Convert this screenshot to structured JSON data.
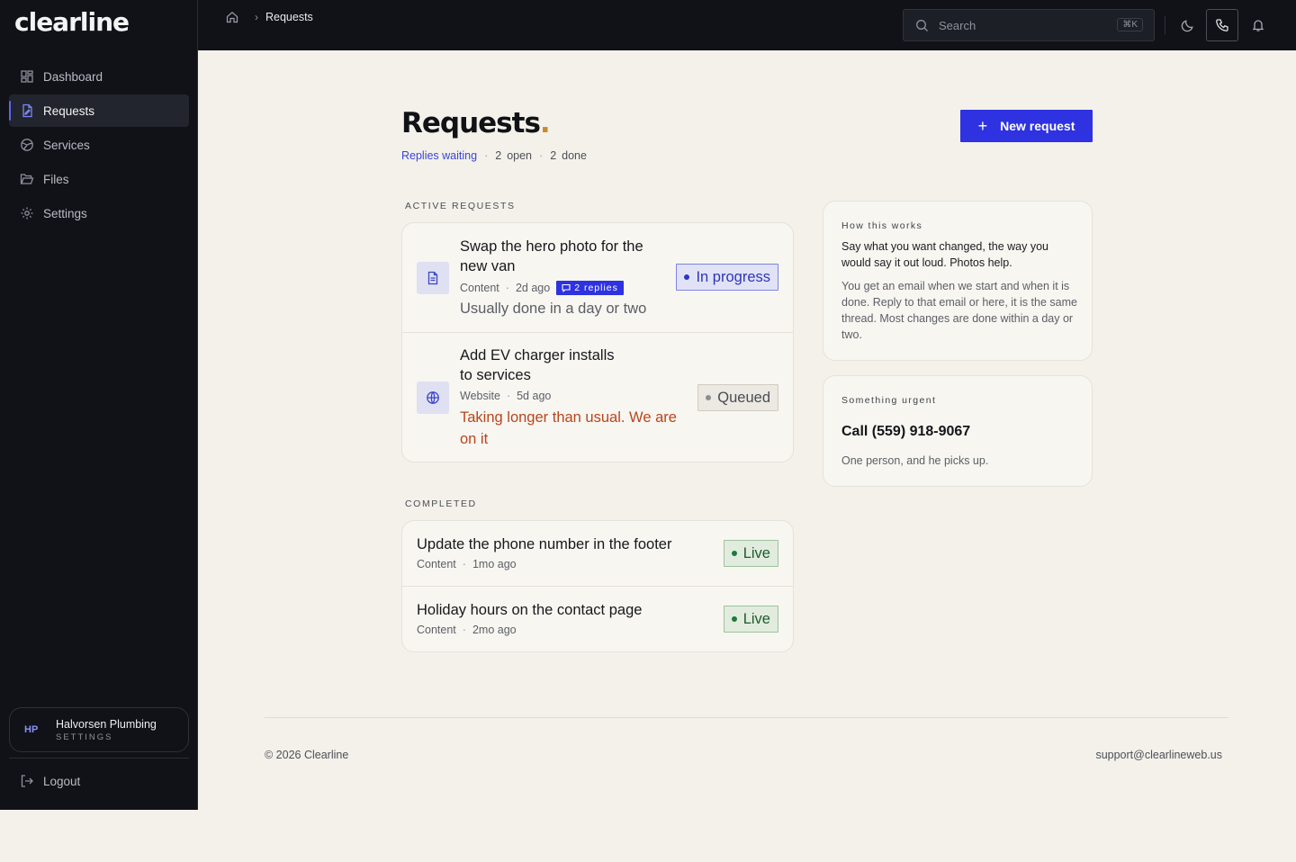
{
  "app": {
    "logo": "clearline"
  },
  "sidebar": {
    "items": [
      {
        "label": "Dashboard",
        "icon": "dashboard-icon"
      },
      {
        "label": "Requests",
        "icon": "requests-icon",
        "active": true
      },
      {
        "label": "Services",
        "icon": "globe-icon"
      },
      {
        "label": "Files",
        "icon": "folder-icon"
      },
      {
        "label": "Settings",
        "icon": "gear-icon"
      }
    ],
    "account": {
      "initials": "HP",
      "name": "Halvorsen Plumbing",
      "sub": "SETTINGS"
    },
    "logout": "Logout"
  },
  "topbar": {
    "breadcrumb": {
      "current": "Requests"
    },
    "search": {
      "placeholder": "Search",
      "shortcut": "⌘K"
    }
  },
  "page": {
    "title": "Requests",
    "title_dot": ".",
    "replies_link": "Replies waiting",
    "open_count": "2",
    "open_label": "open",
    "done_count": "2",
    "done_label": "done",
    "new_button": "New request"
  },
  "active": {
    "label": "ACTIVE REQUESTS",
    "items": [
      {
        "title_line1": "Swap the hero photo for the",
        "title_line2": "new van",
        "category": "Content",
        "age": "2d ago",
        "replies": "2 replies",
        "note": "Usually done in a day or two",
        "status": "In progress",
        "icon": "document-icon"
      },
      {
        "title_line1": "Add EV charger installs",
        "title_line2": "to services",
        "category": "Website",
        "age": "5d ago",
        "note_line1": "Taking longer than usual. We are",
        "note_line2": "on it",
        "status": "Queued",
        "icon": "globe-icon"
      }
    ]
  },
  "completed": {
    "label": "COMPLETED",
    "items": [
      {
        "title": "Update the phone number in the footer",
        "category": "Content",
        "age": "1mo ago",
        "status": "Live"
      },
      {
        "title": "Holiday hours on the contact page",
        "category": "Content",
        "age": "2mo ago",
        "status": "Live"
      }
    ]
  },
  "how": {
    "kicker": "How this works",
    "lead": "Say what you want changed, the way you would say it out loud. Photos help.",
    "body": "You get an email when we start and when it is done. Reply to that email or here, it is the same thread. Most changes are done within a day or two."
  },
  "urgent": {
    "kicker": "Something urgent",
    "phone": "Call (559) 918-9067",
    "note": "One person, and he picks up."
  },
  "footer": {
    "copyright": "© 2026 Clearline",
    "support": "support@clearlineweb.us"
  },
  "colors": {
    "accent": "#2e32e0",
    "sidebar_bg": "#101218",
    "page_bg": "#f3f1ea",
    "warning_text": "#b8451c",
    "live_green": "#1e7a3a"
  }
}
